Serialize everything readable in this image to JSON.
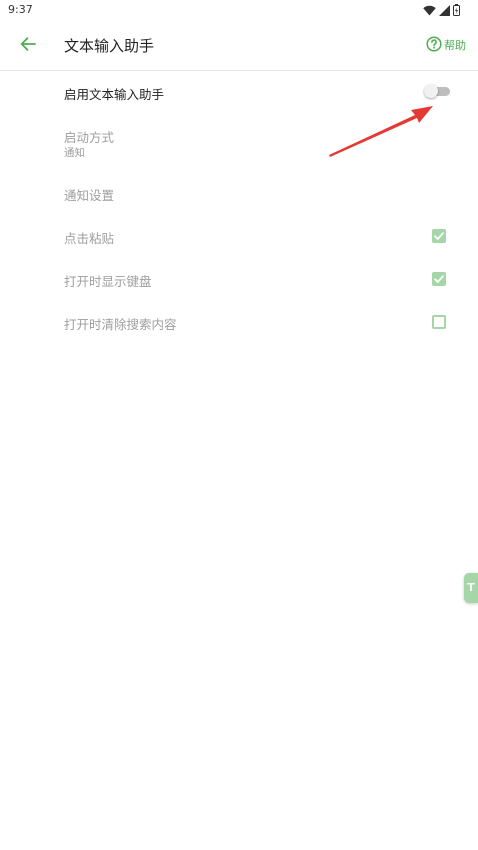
{
  "status_bar": {
    "time": "9:37",
    "icons": [
      "wifi-icon",
      "signal-icon",
      "battery-icon"
    ]
  },
  "app_bar": {
    "title": "文本输入助手",
    "help_label": "帮助"
  },
  "settings": {
    "enable": {
      "label": "启用文本输入助手",
      "enabled": true,
      "toggle_on": false
    },
    "launch_mode": {
      "label": "启动方式",
      "value": "通知",
      "enabled": false
    },
    "notification_settings": {
      "label": "通知设置",
      "enabled": false
    },
    "tap_paste": {
      "label": "点击粘贴",
      "checked": true,
      "enabled": false
    },
    "show_keyboard": {
      "label": "打开时显示键盘",
      "checked": true,
      "enabled": false
    },
    "clear_search": {
      "label": "打开时清除搜索内容",
      "checked": false,
      "enabled": false
    }
  },
  "side_tab": {
    "label": "T"
  },
  "colors": {
    "accent": "#4caf50",
    "accent_light": "#a5d6a7",
    "annotation_arrow": "#e53935",
    "disabled_text": "#9e9e9e"
  }
}
